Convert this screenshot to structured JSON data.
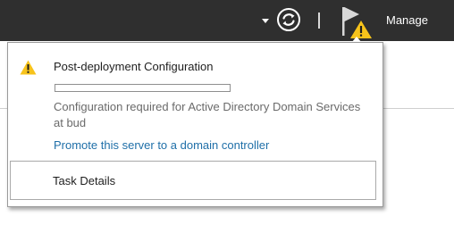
{
  "header": {
    "manage_label": "Manage",
    "icons": {
      "dropdown": "chevron-down-icon",
      "refresh": "refresh-icon",
      "notifications": "flag-warning-icon"
    },
    "colors": {
      "bar": "#2f2f2f",
      "warning": "#f7c31b"
    }
  },
  "notification": {
    "icon": "warning-icon",
    "title": "Post-deployment Configuration",
    "progress_percent": 0,
    "message": "Configuration required for Active Directory Domain Services at bud",
    "link": "Promote this server to a domain controller",
    "task_details_label": "Task Details"
  }
}
